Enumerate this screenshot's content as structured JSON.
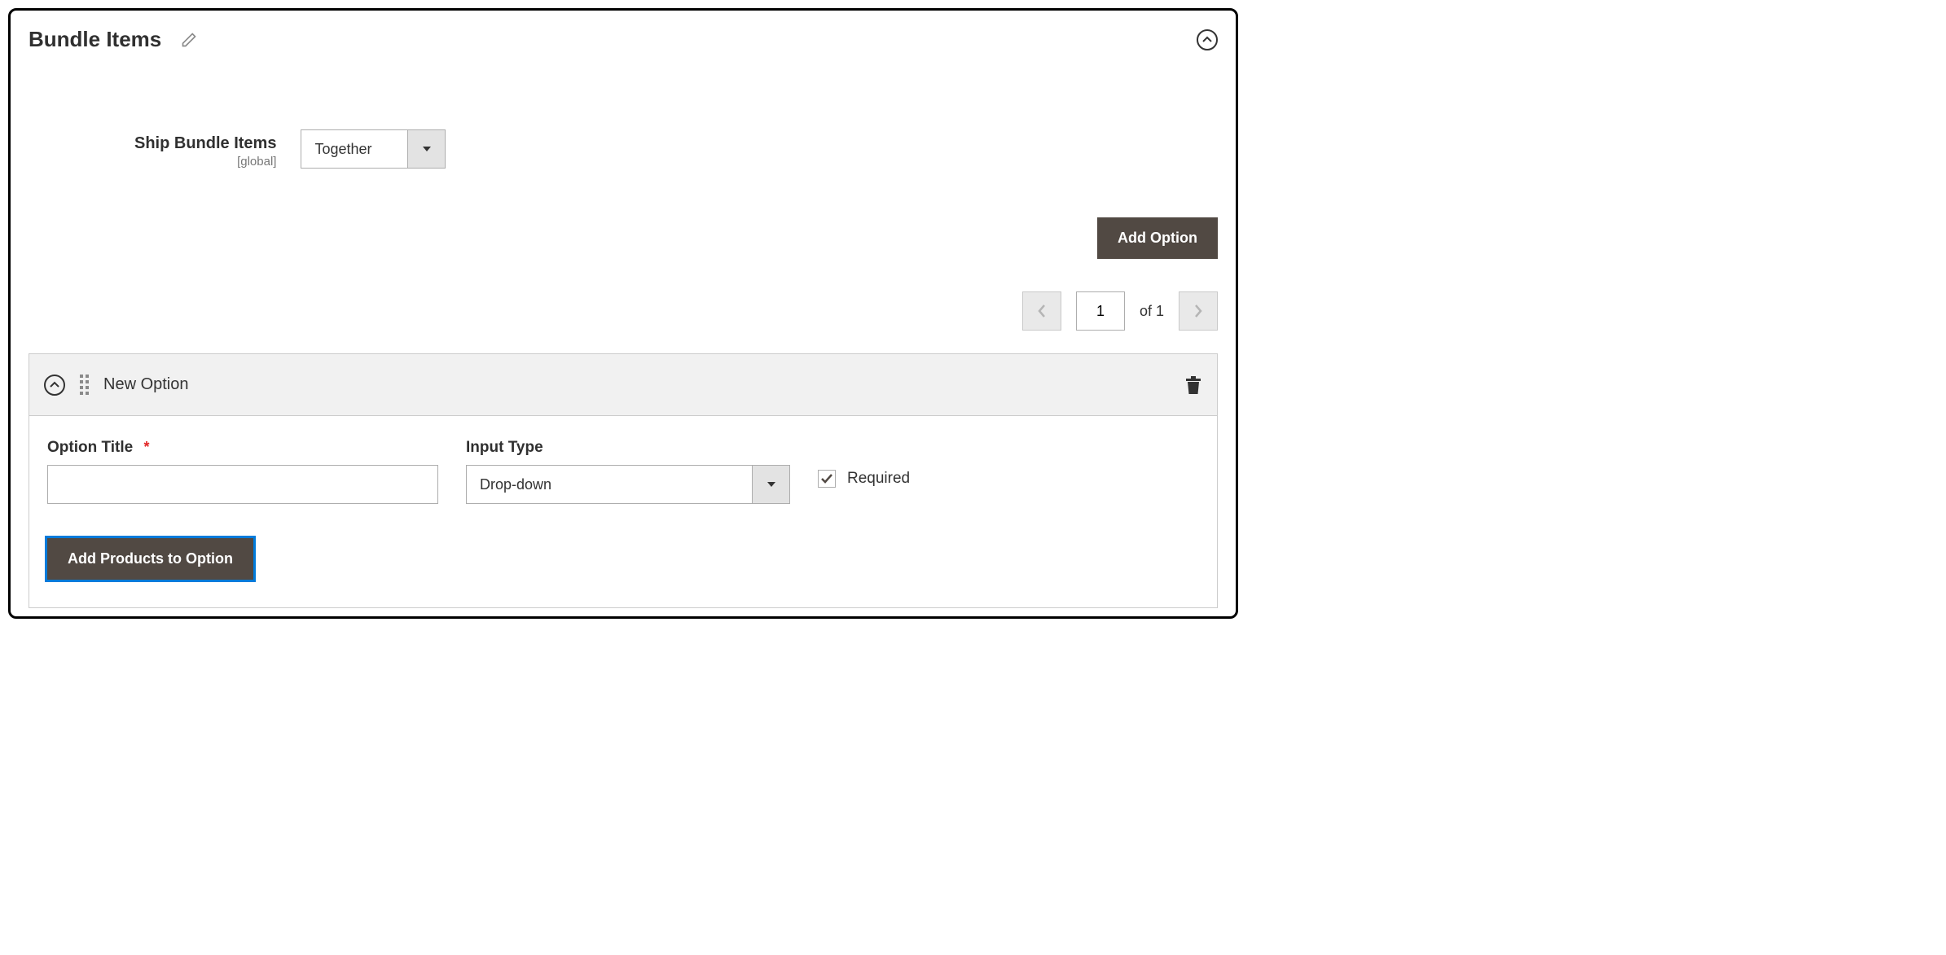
{
  "section": {
    "title": "Bundle Items"
  },
  "ship": {
    "label": "Ship Bundle Items",
    "scope": "[global]",
    "value": "Together"
  },
  "buttons": {
    "add_option": "Add Option",
    "add_products": "Add Products to Option"
  },
  "pager": {
    "page": "1",
    "of_label": "of",
    "total": "1"
  },
  "option": {
    "header_title": "New Option",
    "title_label": "Option Title",
    "title_value": "",
    "input_type_label": "Input Type",
    "input_type_value": "Drop-down",
    "required_label": "Required",
    "required_checked": true
  }
}
